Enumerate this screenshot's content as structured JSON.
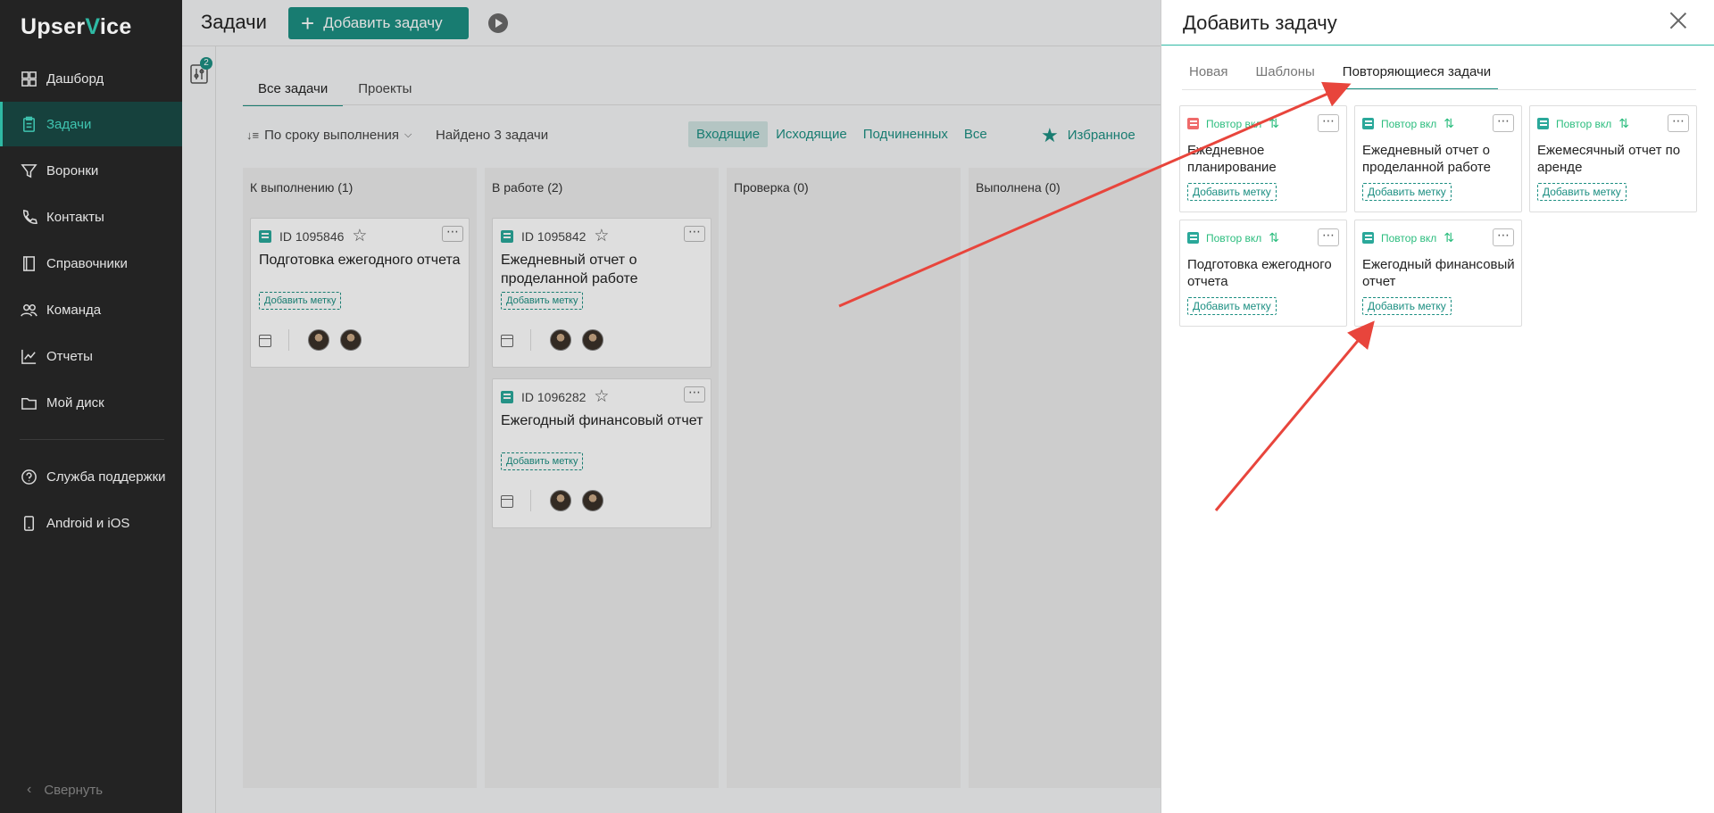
{
  "app": {
    "logo_prefix": "Upser",
    "logo_v": "V",
    "logo_suffix": "ice"
  },
  "sidebar": {
    "items": [
      {
        "label": "Дашборд",
        "icon": "dashboard-icon"
      },
      {
        "label": "Задачи",
        "icon": "tasks-icon",
        "active": true
      },
      {
        "label": "Воронки",
        "icon": "funnel-icon"
      },
      {
        "label": "Контакты",
        "icon": "phone-icon"
      },
      {
        "label": "Справочники",
        "icon": "book-icon"
      },
      {
        "label": "Команда",
        "icon": "team-icon"
      },
      {
        "label": "Отчеты",
        "icon": "chart-icon"
      },
      {
        "label": "Мой диск",
        "icon": "folder-icon"
      }
    ],
    "bottom_items": [
      {
        "label": "Служба поддержки",
        "icon": "help-icon"
      },
      {
        "label": "Android и iOS",
        "icon": "mobile-icon"
      }
    ],
    "collapse_label": "Свернуть"
  },
  "header": {
    "title": "Задачи",
    "add_button": "Добавить задачу"
  },
  "filter_badge": "2",
  "main_tabs": [
    "Все задачи",
    "Проекты"
  ],
  "toolbar": {
    "sort_label": "По сроку выполнения",
    "found": "Найдено 3 задачи",
    "filters": [
      "Входящие",
      "Исходящие",
      "Подчиненных",
      "Все"
    ],
    "favorites": "Избранное"
  },
  "columns": [
    {
      "title": "К выполнению (1)",
      "cards": [
        {
          "id": "ID 1095846",
          "title": "Подготовка ежегодного отчета",
          "tag": "Добавить метку"
        }
      ]
    },
    {
      "title": "В работе (2)",
      "cards": [
        {
          "id": "ID 1095842",
          "title": "Ежедневный отчет о проделанной работе",
          "tag": "Добавить метку"
        },
        {
          "id": "ID 1096282",
          "title": "Ежегодный финансовый отчет",
          "tag": "Добавить метку"
        }
      ]
    },
    {
      "title": "Проверка (0)",
      "cards": []
    },
    {
      "title": "Выполнена (0)",
      "cards": []
    }
  ],
  "panel": {
    "title": "Добавить задачу",
    "tabs": [
      "Новая",
      "Шаблоны",
      "Повторяющиеся задачи"
    ],
    "active_tab": "Повторяющиеся задачи",
    "repeat_label": "Повтор вкл",
    "templates": [
      {
        "title": "Ежедневное планирование",
        "tag": "Добавить метку",
        "icon_color": "#ef6a6a"
      },
      {
        "title": "Ежедневный отчет о проделанной работе",
        "tag": "Добавить метку",
        "icon_color": "#2aa89a"
      },
      {
        "title": "Ежемесячный отчет по аренде",
        "tag": "Добавить метку",
        "icon_color": "#2aa89a"
      },
      {
        "title": "Подготовка ежегодного отчета",
        "tag": "Добавить метку",
        "icon_color": "#2aa89a"
      },
      {
        "title": "Ежегодный финансовый отчет",
        "tag": "Добавить метку",
        "icon_color": "#2aa89a"
      }
    ]
  },
  "colors": {
    "accent": "#1c8f82",
    "sidebar_bg": "#232323",
    "annotation_arrow": "#e8453c",
    "repeat_green": "#2bbd7e"
  }
}
